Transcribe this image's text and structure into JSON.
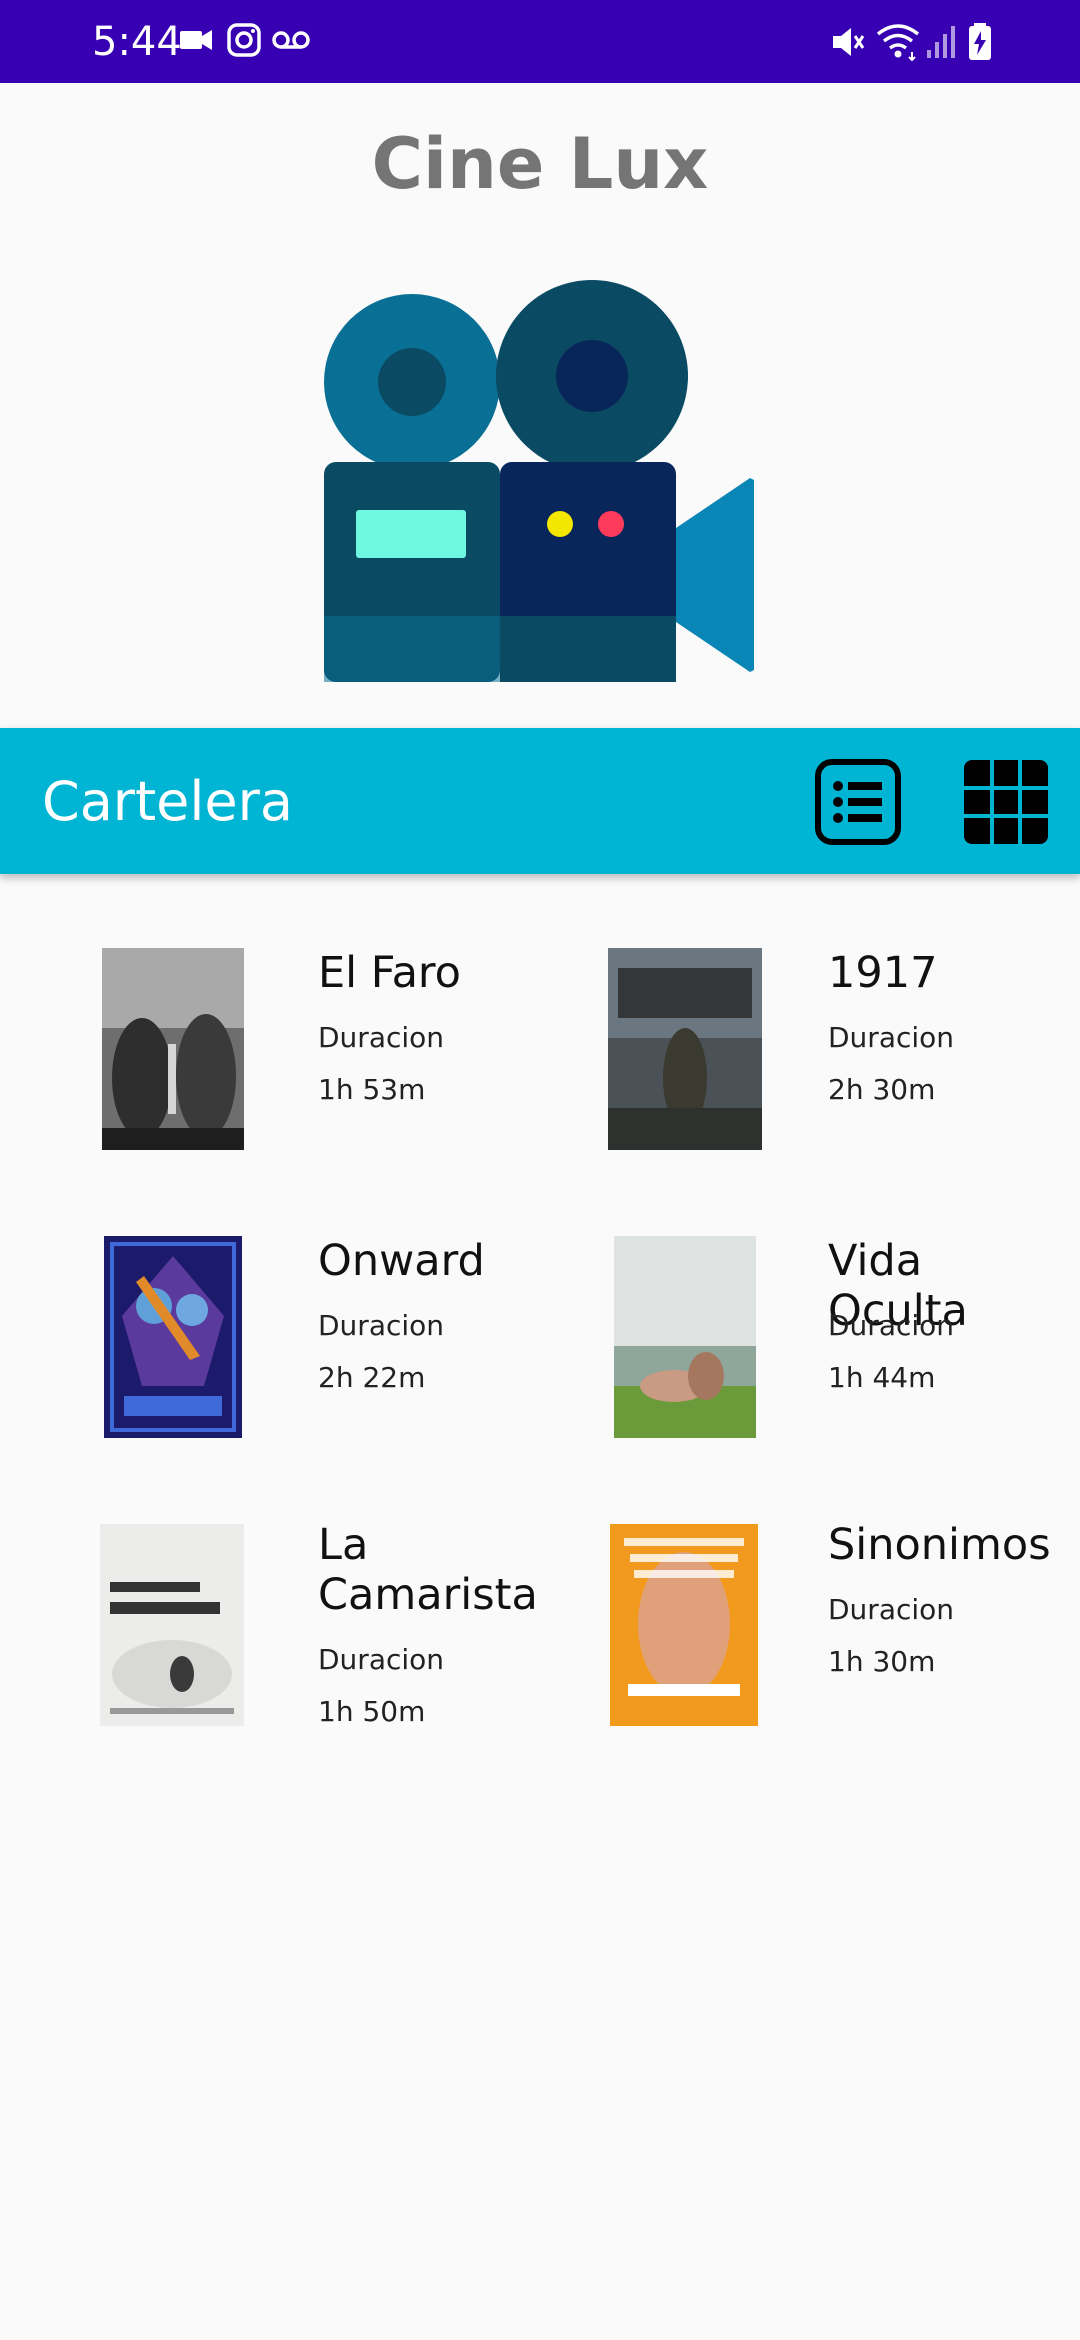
{
  "status_bar": {
    "time": "5:44",
    "left_icons": [
      "video-camera-icon",
      "instagram-icon",
      "voicemail-icon"
    ],
    "right_icons": [
      "mute-icon",
      "wifi-icon",
      "signal-icon",
      "battery-charging-icon"
    ],
    "background": "#3700b3"
  },
  "header": {
    "title": "Cine Lux"
  },
  "toolbar": {
    "title": "Cartelera",
    "background": "#00b4d4",
    "buttons": [
      "list-view-icon",
      "grid-view-icon"
    ]
  },
  "movies": [
    {
      "title": "El Faro",
      "label": "Duracion",
      "duration": "1h 53m"
    },
    {
      "title": "1917",
      "label": "Duracion",
      "duration": "2h 30m"
    },
    {
      "title": "Onward",
      "label": "Duracion",
      "duration": "2h 22m"
    },
    {
      "title": "Vida Oculta",
      "label": "Duracion",
      "duration": "1h 44m"
    },
    {
      "title": "La Camarista",
      "label": "Duracion",
      "duration": "1h 50m"
    },
    {
      "title": "Sinonimos",
      "label": "Duracion",
      "duration": "1h 30m"
    }
  ]
}
